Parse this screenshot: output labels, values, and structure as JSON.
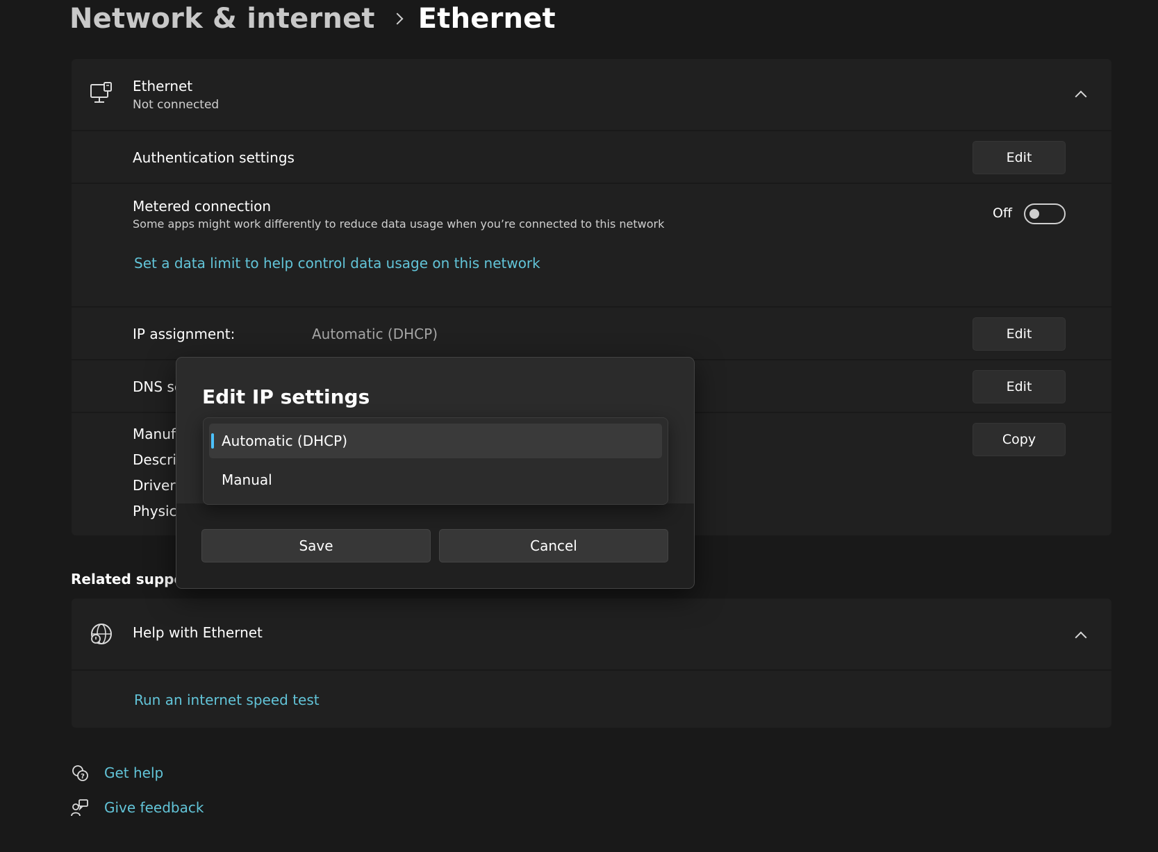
{
  "breadcrumb": {
    "parent": "Network & internet",
    "current": "Ethernet"
  },
  "ethernet_card": {
    "title": "Ethernet",
    "status": "Not connected",
    "auth": {
      "label": "Authentication settings",
      "button": "Edit"
    },
    "metered": {
      "label": "Metered connection",
      "description": "Some apps might work differently to reduce data usage when you’re connected to this network",
      "toggle_state": "Off",
      "link": "Set a data limit to help control data usage on this network"
    },
    "ip": {
      "label": "IP assignment:",
      "value": "Automatic (DHCP)",
      "button": "Edit"
    },
    "dns": {
      "label_visible": "DNS se",
      "button": "Edit"
    },
    "properties": {
      "labels_visible": [
        "Manufa",
        "Descrip",
        "Driver v",
        "Physica"
      ],
      "button": "Copy"
    }
  },
  "related_support": {
    "title": "Related support",
    "help_item": "Help with Ethernet",
    "link": "Run an internet speed test"
  },
  "footer": {
    "get_help": "Get help",
    "give_feedback": "Give feedback"
  },
  "dialog": {
    "title": "Edit IP settings",
    "options": [
      "Automatic (DHCP)",
      "Manual"
    ],
    "selected": "Automatic (DHCP)",
    "save": "Save",
    "cancel": "Cancel"
  },
  "colors": {
    "background": "#191919",
    "card": "#202020",
    "link": "#62c4d8",
    "accent": "#4cc2ff"
  }
}
